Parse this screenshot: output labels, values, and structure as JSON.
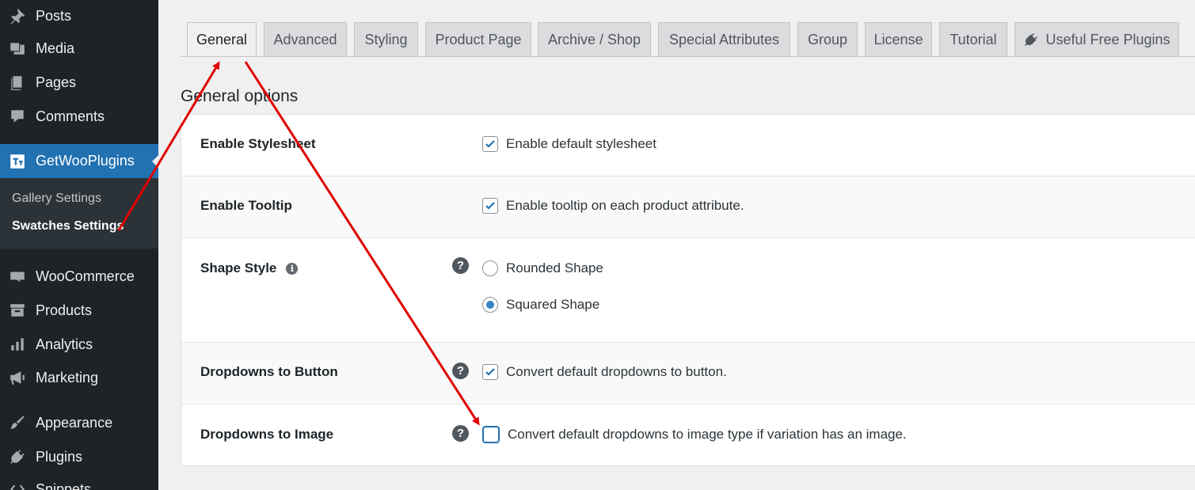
{
  "sidebar": {
    "items": [
      {
        "label": "Posts",
        "icon": "pin-icon"
      },
      {
        "label": "Media",
        "icon": "media-icon"
      },
      {
        "label": "Pages",
        "icon": "pages-icon"
      },
      {
        "label": "Comments",
        "icon": "comment-icon"
      },
      {
        "label": "GetWooPlugins",
        "icon": "plugin-brand-icon"
      },
      {
        "label": "WooCommerce",
        "icon": "woo-icon"
      },
      {
        "label": "Products",
        "icon": "archive-icon"
      },
      {
        "label": "Analytics",
        "icon": "bar-chart-icon"
      },
      {
        "label": "Marketing",
        "icon": "megaphone-icon"
      },
      {
        "label": "Appearance",
        "icon": "paintbrush-icon"
      },
      {
        "label": "Plugins",
        "icon": "plug-icon"
      },
      {
        "label": "Snippets",
        "icon": "snippet-icon"
      }
    ],
    "submenu": [
      "Gallery Settings",
      "Swatches Settings"
    ]
  },
  "tabs": [
    {
      "label": "General"
    },
    {
      "label": "Advanced"
    },
    {
      "label": "Styling"
    },
    {
      "label": "Product Page"
    },
    {
      "label": "Archive / Shop"
    },
    {
      "label": "Special Attributes"
    },
    {
      "label": "Group"
    },
    {
      "label": "License"
    },
    {
      "label": "Tutorial"
    },
    {
      "label": "Useful Free Plugins"
    }
  ],
  "section_title": "General options",
  "settings": {
    "stylesheet": {
      "label": "Enable Stylesheet",
      "option": "Enable default stylesheet",
      "checked": true
    },
    "tooltip": {
      "label": "Enable Tooltip",
      "option": "Enable tooltip on each product attribute.",
      "checked": true
    },
    "shape": {
      "label": "Shape Style",
      "options": [
        "Rounded Shape",
        "Squared Shape"
      ],
      "selected": "Squared Shape"
    },
    "dropdown_button": {
      "label": "Dropdowns to Button",
      "option": "Convert default dropdowns to button.",
      "checked": true
    },
    "dropdown_image": {
      "label": "Dropdowns to Image",
      "option": "Convert default dropdowns to image type if variation has an image.",
      "checked": false
    }
  },
  "help_glyph": "?",
  "info_glyph": "i",
  "colors": {
    "accent": "#2271b1",
    "sidebar": "#1d2327",
    "annotation": "#e00000"
  }
}
